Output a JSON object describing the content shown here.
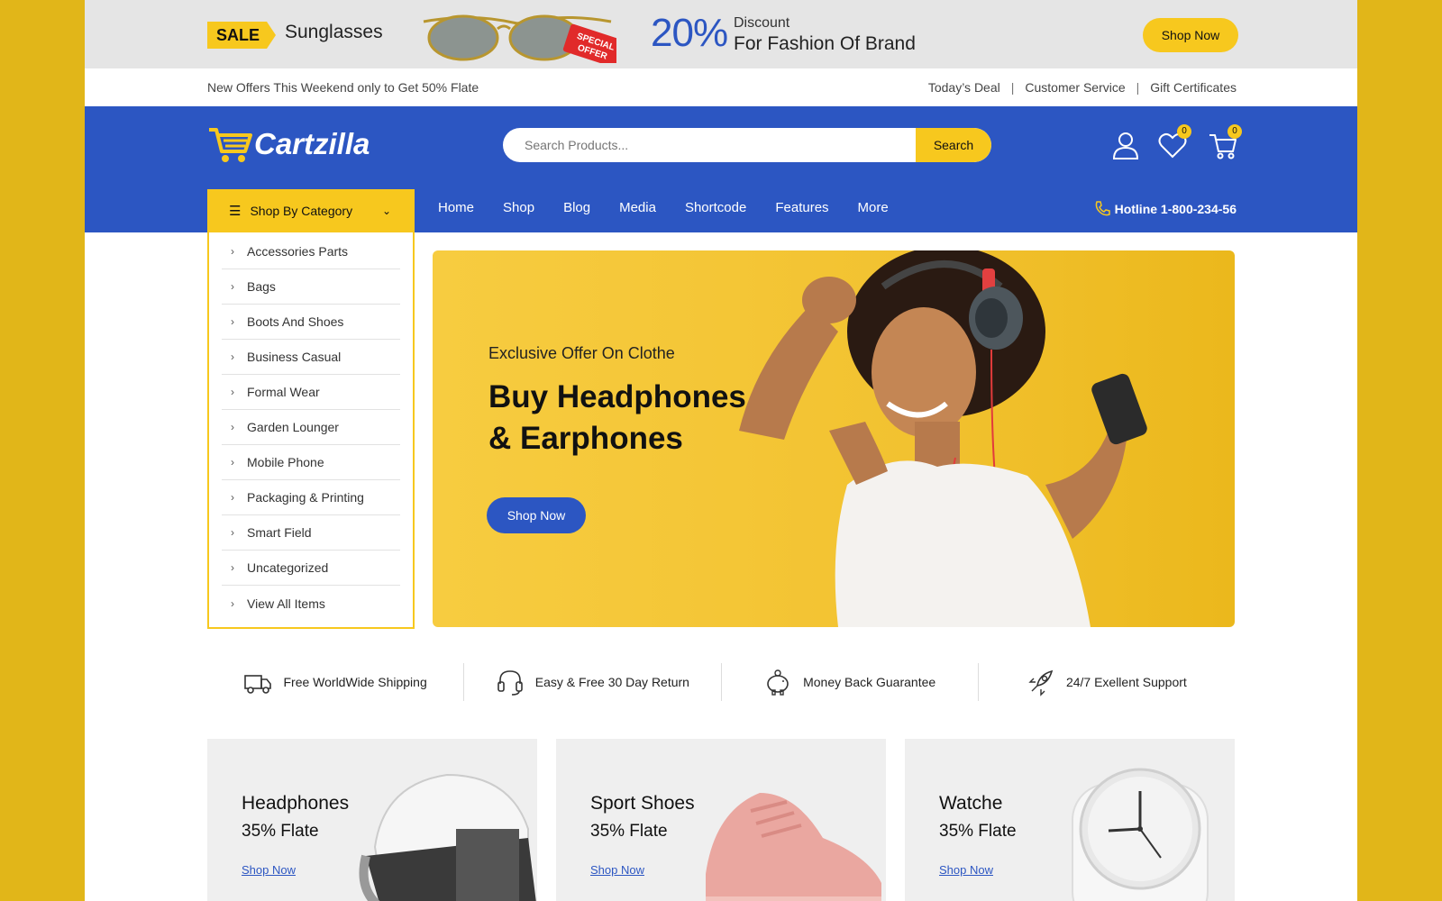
{
  "promo": {
    "sale_label": "SALE",
    "product": "Sunglasses",
    "special_offer": "SPECIAL OFFER",
    "percent": "20%",
    "discount_label": "Discount",
    "discount_text": "For Fashion Of Brand",
    "shop_now": "Shop Now"
  },
  "infobar": {
    "offer_text": "New Offers This Weekend only to Get 50% Flate",
    "links": [
      "Today’s Deal",
      "Customer Service",
      "Gift Certificates"
    ],
    "separator": "|"
  },
  "header": {
    "logo_text": "Cartzilla",
    "search_placeholder": "Search Products...",
    "search_button": "Search",
    "wishlist_count": "0",
    "cart_count": "0"
  },
  "nav": {
    "category_label": "Shop By Category",
    "items": [
      "Home",
      "Shop",
      "Blog",
      "Media",
      "Shortcode",
      "Features",
      "More"
    ],
    "hotline": "Hotline 1-800-234-56"
  },
  "categories": [
    "Accessories Parts",
    "Bags",
    "Boots And Shoes",
    "Business Casual",
    "Formal Wear",
    "Garden Lounger",
    "Mobile Phone",
    "Packaging & Printing",
    "Smart Field",
    "Uncategorized",
    "View All Items"
  ],
  "hero": {
    "subtitle": "Exclusive Offer On Clothe",
    "title": "Buy Headphones & Earphones",
    "button": "Shop Now"
  },
  "features": [
    {
      "icon": "truck-icon",
      "text": "Free WorldWide Shipping"
    },
    {
      "icon": "headset-icon",
      "text": "Easy & Free 30 Day Return"
    },
    {
      "icon": "piggy-bank-icon",
      "text": "Money Back Guarantee"
    },
    {
      "icon": "rocket-icon",
      "text": "24/7 Exellent Support"
    }
  ],
  "banners": [
    {
      "title": "Headphones",
      "subtitle": "35% Flate",
      "link": "Shop Now"
    },
    {
      "title": "Sport Shoes",
      "subtitle": "35% Flate",
      "link": "Shop Now"
    },
    {
      "title": "Watche",
      "subtitle": "35% Flate",
      "link": "Shop Now"
    }
  ],
  "colors": {
    "brand_blue": "#2c56c2",
    "accent_yellow": "#f7c81e",
    "outer_background": "#e1b619"
  }
}
